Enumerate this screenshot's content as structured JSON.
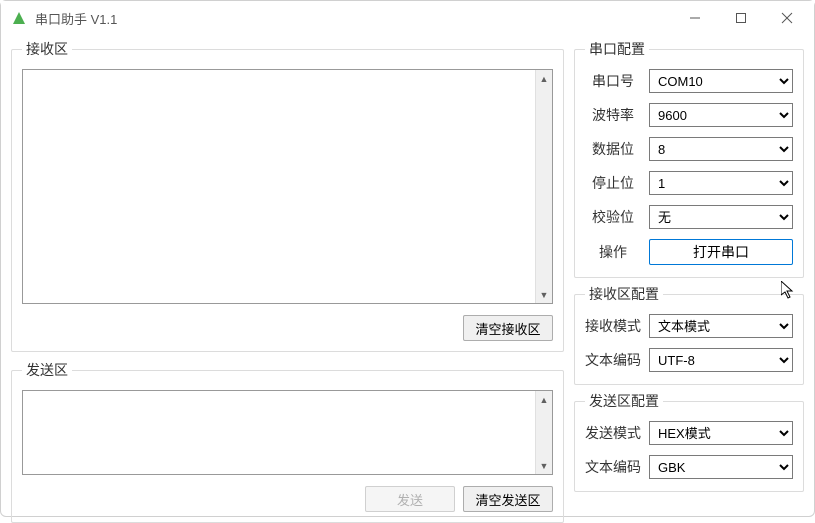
{
  "window": {
    "title": "串口助手 V1.1"
  },
  "receive_area": {
    "legend": "接收区",
    "value": "",
    "clear_button": "清空接收区"
  },
  "send_area": {
    "legend": "发送区",
    "value": "",
    "send_button": "发送",
    "clear_button": "清空发送区"
  },
  "port_config": {
    "legend": "串口配置",
    "port_label": "串口号",
    "port_value": "COM10",
    "baud_label": "波特率",
    "baud_value": "9600",
    "databits_label": "数据位",
    "databits_value": "8",
    "stopbits_label": "停止位",
    "stopbits_value": "1",
    "parity_label": "校验位",
    "parity_value": "无",
    "action_label": "操作",
    "open_button": "打开串口"
  },
  "recv_config": {
    "legend": "接收区配置",
    "mode_label": "接收模式",
    "mode_value": "文本模式",
    "encoding_label": "文本编码",
    "encoding_value": "UTF-8"
  },
  "send_config": {
    "legend": "发送区配置",
    "mode_label": "发送模式",
    "mode_value": "HEX模式",
    "encoding_label": "文本编码",
    "encoding_value": "GBK"
  }
}
